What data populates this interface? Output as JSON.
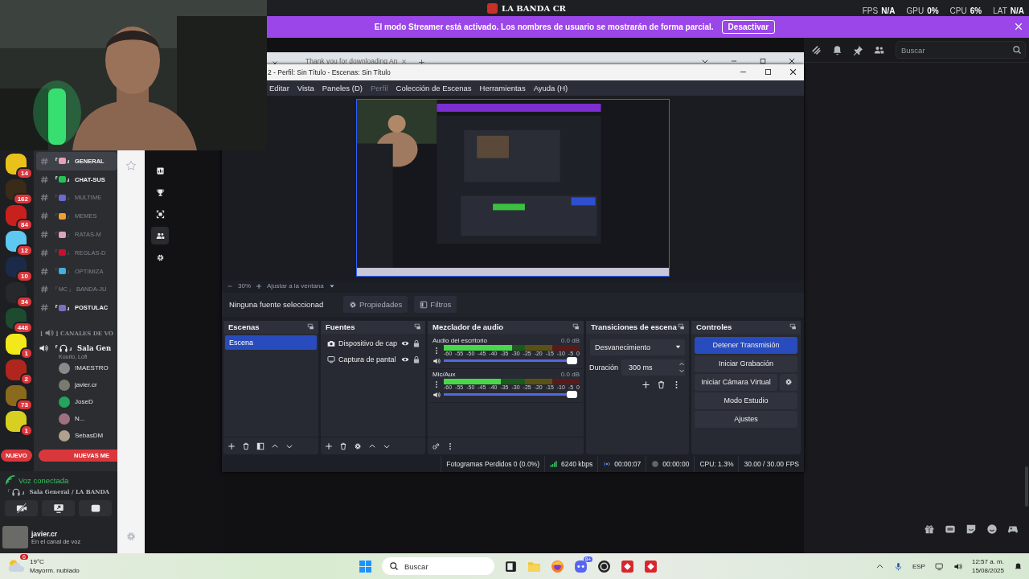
{
  "topbar": {
    "title": "LA BANDA CR",
    "stats": [
      {
        "label": "FPS",
        "value": "N/A"
      },
      {
        "label": "GPU",
        "value": "0%"
      },
      {
        "label": "CPU",
        "value": "6%"
      },
      {
        "label": "LAT",
        "value": "N/A"
      }
    ]
  },
  "banner": {
    "text": "El modo Streamer está activado. Los nombres de usuario se mostrarán de forma parcial.",
    "button": "Desactivar"
  },
  "servers": [
    {
      "badge": "14",
      "color": "#e8c21a"
    },
    {
      "badge": "162",
      "color": "#3a2a18"
    },
    {
      "badge": "84",
      "color": "#c8201c"
    },
    {
      "badge": "12",
      "color": "#5ec8f0"
    },
    {
      "badge": "10",
      "color": "#1c2a4a"
    },
    {
      "badge": "34",
      "color": "#26282c"
    },
    {
      "badge": "448",
      "color": "#1e4a30"
    },
    {
      "badge": "1",
      "color": "#f2e81a"
    },
    {
      "badge": "2",
      "color": "#b0261c"
    },
    {
      "badge": "73",
      "color": "#8a6a1c"
    },
    {
      "badge": "1",
      "color": "#d8d020"
    }
  ],
  "channels": [
    {
      "open": "『",
      "close": "』",
      "name": "GENERAL",
      "kind": "emoji",
      "color": "#e8a0b8",
      "unread": true,
      "selected": true
    },
    {
      "open": "『",
      "close": "』",
      "name": "CHAT-SUS",
      "kind": "emoji",
      "color": "#23c552",
      "unread": true,
      "selected": false
    },
    {
      "open": "『",
      "close": "』",
      "name": "MULTIME",
      "kind": "emoji",
      "color": "#6a6ad0",
      "unread": false,
      "selected": false
    },
    {
      "open": "『",
      "close": "』",
      "name": "MEMES",
      "kind": "emoji",
      "color": "#f0a030",
      "unread": false,
      "selected": false
    },
    {
      "open": "『",
      "close": "』",
      "name": "RATAS-M",
      "kind": "emoji",
      "color": "#e0a0c0",
      "unread": false,
      "selected": false
    },
    {
      "open": "『",
      "close": "』",
      "name": "REGLAS-D",
      "kind": "emoji",
      "color": "#c8102e",
      "unread": false,
      "selected": false
    },
    {
      "open": "『",
      "close": "』",
      "name": "OPTIMIZA",
      "kind": "emoji",
      "color": "#40b0e0",
      "unread": false,
      "selected": false
    },
    {
      "open": "『",
      "close": "』",
      "name": "BANDA-JU",
      "kind": "tag",
      "tag": "MC",
      "unread": false,
      "selected": false
    },
    {
      "open": "『",
      "close": "』",
      "name": "POSTULAC",
      "kind": "emoji",
      "color": "#7a70c0",
      "unread": true,
      "selected": false
    }
  ],
  "voice_category": {
    "open": "[",
    "close": "]",
    "name": "CANALES DE VO"
  },
  "voice_channel": {
    "open": "『",
    "close": "』",
    "name": "Sala Gen",
    "activity": "Kourio, Lofi",
    "members": [
      {
        "name": "!MAESTRO",
        "color": "#8a8a8a"
      },
      {
        "name": "javier.cr",
        "color": "#7a7a70"
      },
      {
        "name": "JoseD",
        "color": "#23a55a"
      },
      {
        "name": "N...",
        "color": "#a07080"
      },
      {
        "name": "SebasDM",
        "color": "#b0a090"
      }
    ]
  },
  "new_pills": {
    "nuevo": "NUEVO",
    "messages": "NUEVAS ME"
  },
  "voice_panel": {
    "status": "Voz conectada",
    "open": "『",
    "close": "』",
    "channel": "Sala General / LA BANDA"
  },
  "user": {
    "name": "javier.cr",
    "status": "En el canal de voz"
  },
  "chat_header": {
    "placeholder": "Buscar"
  },
  "browser": {
    "tab": "Thank you for downloading An"
  },
  "obs": {
    "title": "2 - Perfil: Sin Título - Escenas: Sin Título",
    "menu": [
      {
        "label": "Editar",
        "disabled": false
      },
      {
        "label": "Vista",
        "disabled": false
      },
      {
        "label": "Paneles (D)",
        "disabled": false
      },
      {
        "label": "Perfil",
        "disabled": true
      },
      {
        "label": "Colección de Escenas",
        "disabled": false
      },
      {
        "label": "Herramientas",
        "disabled": false
      },
      {
        "label": "Ayuda (H)",
        "disabled": false
      }
    ],
    "zoom": "30%",
    "fit": "Ajustar a la ventana",
    "source_bar": {
      "status": "Ninguna fuente seleccionad",
      "properties": "Propiedades",
      "filters": "Filtros"
    },
    "scenes": {
      "title": "Escenas",
      "items": [
        {
          "name": "Escena",
          "selected": true
        }
      ]
    },
    "sources": {
      "title": "Fuentes",
      "items": [
        {
          "name": "Dispositivo de cap",
          "kind": "camera",
          "visible": true
        },
        {
          "name": "Captura de pantal",
          "kind": "display",
          "visible": true
        }
      ]
    },
    "mixer": {
      "title": "Mezclador de audio",
      "channels": [
        {
          "name": "Audio del escritorio",
          "reading": "0.0 dB",
          "meter": {
            "level": 0.5
          },
          "volume": {
            "level": 1
          },
          "scale": [
            "-60",
            "-55",
            "-50",
            "-45",
            "-40",
            "-35",
            "-30",
            "-25",
            "-20",
            "-15",
            "-10",
            "-5",
            "0"
          ]
        },
        {
          "name": "Mic/Aux",
          "reading": "0.0 dB",
          "meter": {
            "level": 0.42
          },
          "volume": {
            "level": 1
          },
          "scale": [
            "-60",
            "-55",
            "-50",
            "-45",
            "-40",
            "-35",
            "-30",
            "-25",
            "-20",
            "-15",
            "-10",
            "-5",
            "0"
          ]
        }
      ]
    },
    "transitions": {
      "title": "Transiciones de escena",
      "value": "Desvanecimiento",
      "duration_label": "Duración",
      "duration": "300 ms"
    },
    "controls": {
      "title": "Controles",
      "buttons": [
        {
          "label": "Detener Transmisión",
          "active": true
        },
        {
          "label": "Iniciar Grabación",
          "active": false
        },
        {
          "label": "Iniciar Cámara Virtual",
          "active": false
        },
        {
          "label": "Modo Estudio",
          "active": false
        },
        {
          "label": "Ajustes",
          "active": false
        }
      ]
    },
    "status": {
      "dropped": "Fotogramas Perdidos 0 (0.0%)",
      "bitrate": "6240 kbps",
      "live": "00:00:07",
      "recording": "00:00:00",
      "cpu": "CPU: 1.3%",
      "fps": "30.00 / 30.00 FPS"
    }
  },
  "taskbar": {
    "weather_badge": "6",
    "temperature": "19°C",
    "condition": "Mayorm. nublado",
    "search": {
      "placeholder": "Buscar"
    },
    "discord_badge": "9+",
    "language": "ESP",
    "time": "12:57 a. m.",
    "date": "15/08/2025"
  }
}
